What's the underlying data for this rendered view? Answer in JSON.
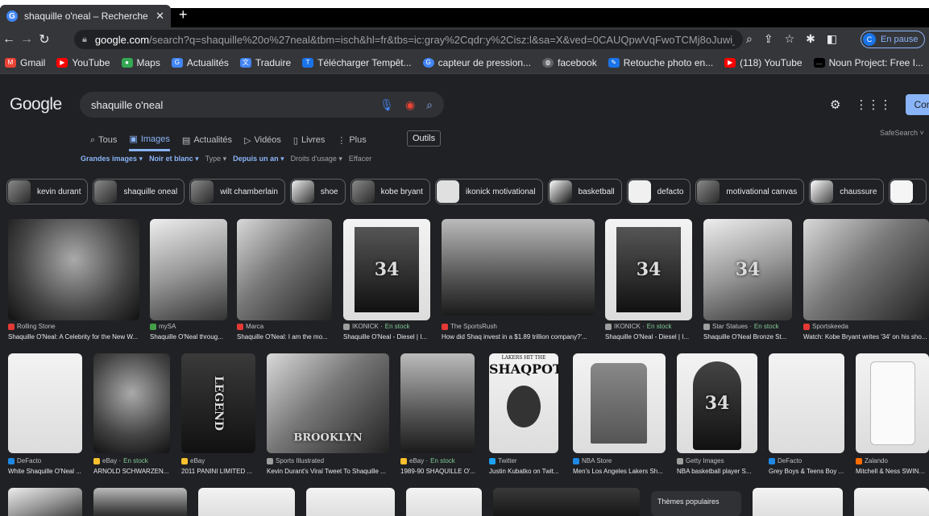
{
  "browser": {
    "tab_title": "shaquille o'neal – Recherche Goo",
    "url_domain": "google.com",
    "url_path": "/search?q=shaquille%20o%27neal&tbm=isch&hl=fr&tbs=ic:gray%2Cqdr:y%2Cisz:l&sa=X&ved=0CAUQpwVqFwoTCMj8oJuwi_4CFQAA...",
    "profile_initial": "C",
    "profile_label": "En pause"
  },
  "bookmarks": [
    {
      "label": "Gmail",
      "color": "#ea4335"
    },
    {
      "label": "YouTube",
      "color": "#ff0000"
    },
    {
      "label": "Maps",
      "color": "#34a853"
    },
    {
      "label": "Actualités",
      "color": "#4285f4"
    },
    {
      "label": "Traduire",
      "color": "#4285f4"
    },
    {
      "label": "Télécharger Tempêt...",
      "color": "#1a73e8"
    },
    {
      "label": "capteur de pression...",
      "color": "#4285f4"
    },
    {
      "label": "facebook",
      "color": "#5f6368"
    },
    {
      "label": "Retouche photo en...",
      "color": "#1a73e8"
    },
    {
      "label": "(118) YouTube",
      "color": "#ff0000"
    },
    {
      "label": "Noun Project: Free I...",
      "color": "#000000"
    }
  ],
  "header": {
    "logo": "Google",
    "query": "shaquille o'neal",
    "signin": "Connexion",
    "safesearch": "SafeSearch ˅"
  },
  "nav": {
    "tabs": [
      {
        "label": "Tous",
        "icon": "search-icon",
        "glyph": "⌕"
      },
      {
        "label": "Images",
        "icon": "image-icon",
        "glyph": "▣"
      },
      {
        "label": "Actualités",
        "icon": "news-icon",
        "glyph": "▤"
      },
      {
        "label": "Vidéos",
        "icon": "video-icon",
        "glyph": "▷"
      },
      {
        "label": "Livres",
        "icon": "book-icon",
        "glyph": "▯"
      },
      {
        "label": "Plus",
        "icon": "more-icon",
        "glyph": "⋮"
      }
    ],
    "tools": "Outils"
  },
  "filters": {
    "size": "Grandes images ▾",
    "color": "Noir et blanc ▾",
    "type": "Type ▾",
    "time": "Depuis un an ▾",
    "rights": "Droits d'usage ▾",
    "clear": "Effacer"
  },
  "chips": [
    "kevin durant",
    "shaquille oneal",
    "wilt chamberlain",
    "shoe",
    "kobe bryant",
    "ikonick motivational",
    "basketball",
    "defacto",
    "motivational canvas",
    "chaussure",
    ""
  ],
  "row1": [
    {
      "source": "Rolling Stone",
      "stock": "",
      "caption": "Shaquille O'Neal: A Celebrity for the New W...",
      "srccolor": "#e53935"
    },
    {
      "source": "mySA",
      "stock": "",
      "caption": "Shaquille O'Neal throug...",
      "srccolor": "#43a047"
    },
    {
      "source": "Marca",
      "stock": "",
      "caption": "Shaquille O'Neal: I am the mo...",
      "srccolor": "#e53935"
    },
    {
      "source": "IKONICK · ",
      "stock": "En stock",
      "caption": "Shaquille O'Neal - Diesel | I...",
      "srccolor": "#9e9e9e"
    },
    {
      "source": "The SportsRush",
      "stock": "",
      "caption": "How did Shaq invest in a $1.89 trillion company?'...",
      "srccolor": "#e53935"
    },
    {
      "source": "IKONICK · ",
      "stock": "En stock",
      "caption": "Shaquille O'Neal - Diesel | I...",
      "srccolor": "#9e9e9e"
    },
    {
      "source": "Star Statues · ",
      "stock": "En stock",
      "caption": "Shaquille O'Neal Bronze St...",
      "srccolor": "#9e9e9e"
    },
    {
      "source": "Sportskeeda",
      "stock": "",
      "caption": "Watch: Kobe Bryant writes '34' on his sho...",
      "srccolor": "#e53935"
    }
  ],
  "row1_overlays": {
    "jersey1": "34",
    "jersey2": "34",
    "jersey3": "34"
  },
  "row2": [
    {
      "source": "DeFacto",
      "stock": "",
      "caption": "White Shaquille O'Neal ...",
      "srccolor": "#1e88e5"
    },
    {
      "source": "eBay · ",
      "stock": "En stock",
      "caption": "ARNOLD SCHWARZEN...",
      "srccolor": "#fbc02d"
    },
    {
      "source": "eBay",
      "stock": "",
      "caption": "2011 PANINI LIMITED ...",
      "srccolor": "#fbc02d"
    },
    {
      "source": "Sports Illustrated",
      "stock": "",
      "caption": "Kevin Durant's Viral Tweet To Shaquille ...",
      "srccolor": "#9e9e9e"
    },
    {
      "source": "eBay · ",
      "stock": "En stock",
      "caption": "1989-90 SHAQUILLE O'...",
      "srccolor": "#fbc02d"
    },
    {
      "source": "Twitter",
      "stock": "",
      "caption": "Justin Kubatko on Twit...",
      "srccolor": "#1da1f2"
    },
    {
      "source": "NBA Store",
      "stock": "",
      "caption": "Men's Los Angeles Lakers Sh...",
      "srccolor": "#1e88e5"
    },
    {
      "source": "Getty Images",
      "stock": "",
      "caption": "NBA basketball player S...",
      "srccolor": "#9e9e9e"
    },
    {
      "source": "DeFacto",
      "stock": "",
      "caption": "Grey Boys & Teens Boy ...",
      "srccolor": "#1e88e5"
    },
    {
      "source": "Zalando",
      "stock": "",
      "caption": "Mitchell & Ness SWING...",
      "srccolor": "#ff6d00"
    }
  ],
  "row2_overlays": {
    "shaqpot_top": "LAKERS HIT THE",
    "shaqpot": "SHAQPOT",
    "jersey": "34",
    "brooklyn": "BROOKLYN",
    "legend": "LEGEND"
  },
  "popular": "Thèmes populaires"
}
